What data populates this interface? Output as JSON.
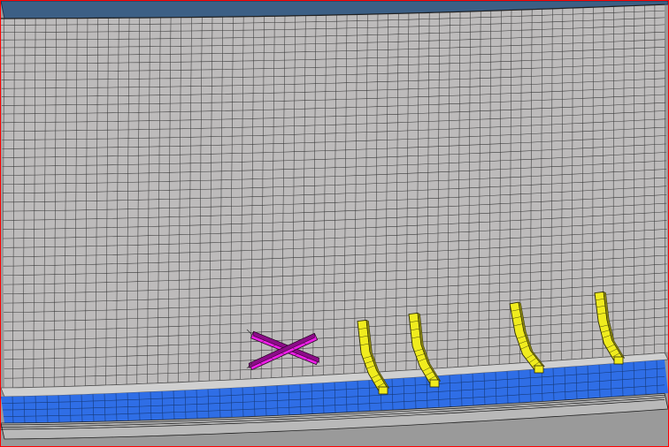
{
  "viewport": {
    "name": "mesh-viewport",
    "border_color": "#ff0000",
    "background_color": "#9a9a9a"
  },
  "colors": {
    "top_panel": "#3c5f85",
    "panel_surface": "#bdbbbb",
    "mesh_line": "#3a3a3a",
    "rocker_base": "#2f6ee6",
    "rocker_shadow": "#1d3f8a",
    "rim_band": "#d0d0d0",
    "cross_brace": "#ee1ee8",
    "cross_brace_dark": "#8c0c88",
    "stiffener": "#f0ec1e",
    "stiffener_dark": "#8a8610"
  },
  "parts": {
    "top_panel": "top-panel-surface",
    "body_panel": "body-panel-mesh",
    "rocker": "rocker-flange-mesh",
    "cross_brace": "cross-brace-part",
    "stiffeners": [
      "stiffener-1",
      "stiffener-2",
      "stiffener-3",
      "stiffener-4"
    ]
  }
}
